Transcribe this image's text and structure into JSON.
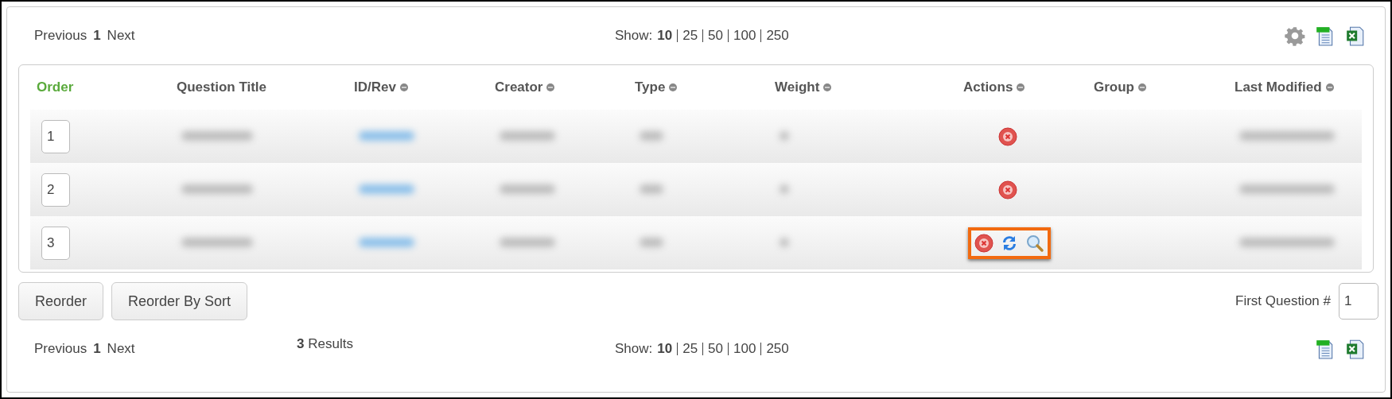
{
  "top_bar": {
    "pager": {
      "previous": "Previous",
      "page": "1",
      "next": "Next"
    },
    "show": {
      "label": "Show:",
      "options": [
        {
          "label": "10",
          "selected": true
        },
        {
          "label": "25",
          "selected": false
        },
        {
          "label": "50",
          "selected": false
        },
        {
          "label": "100",
          "selected": false
        },
        {
          "label": "250",
          "selected": false
        }
      ]
    },
    "tools": [
      {
        "kind": "settings"
      },
      {
        "kind": "csv"
      },
      {
        "kind": "excel"
      }
    ]
  },
  "table": {
    "columns": [
      {
        "label": "Order",
        "selected": true,
        "sortable": false
      },
      {
        "label": "Question Title",
        "selected": false,
        "sortable": false
      },
      {
        "label": "ID/Rev",
        "selected": false,
        "sortable": true
      },
      {
        "label": "Creator",
        "selected": false,
        "sortable": true
      },
      {
        "label": "Type",
        "selected": false,
        "sortable": true
      },
      {
        "label": "Weight",
        "selected": false,
        "sortable": true
      },
      {
        "label": "Actions",
        "selected": false,
        "sortable": true
      },
      {
        "label": "Group",
        "selected": false,
        "sortable": true
      },
      {
        "label": "Last Modified",
        "selected": false,
        "sortable": true
      }
    ],
    "rows": [
      {
        "order": "1",
        "actions": [
          {
            "kind": "delete"
          }
        ],
        "highlighted": false
      },
      {
        "order": "2",
        "actions": [
          {
            "kind": "delete"
          }
        ],
        "highlighted": false
      },
      {
        "order": "3",
        "actions": [
          {
            "kind": "delete"
          },
          {
            "kind": "replace"
          },
          {
            "kind": "view"
          }
        ],
        "highlighted": true
      }
    ]
  },
  "buttons": [
    "Reorder",
    "Reorder By Sort"
  ],
  "first_question": {
    "label": "First Question #",
    "value": "1"
  },
  "bottom_bar": {
    "pager": {
      "previous": "Previous",
      "page": "1",
      "next": "Next"
    },
    "results": "**3** Results",
    "show": {
      "label": "Show:",
      "options": [
        {
          "label": "10",
          "selected": true
        },
        {
          "label": "25",
          "selected": false
        },
        {
          "label": "50",
          "selected": false
        },
        {
          "label": "100",
          "selected": false
        },
        {
          "label": "250",
          "selected": false
        }
      ]
    },
    "tools": [
      {
        "kind": "csv"
      },
      {
        "kind": "excel"
      }
    ]
  }
}
